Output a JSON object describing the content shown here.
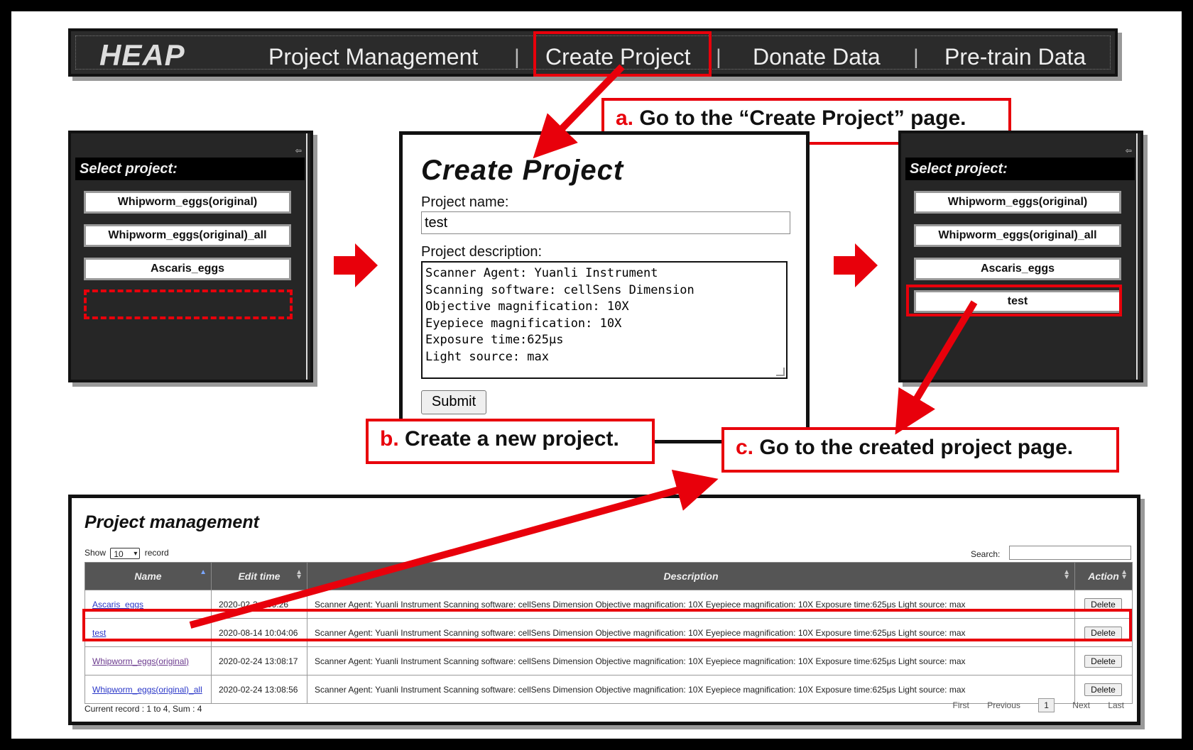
{
  "nav": {
    "logo": "HEAP",
    "items": [
      "Project Management",
      "Create Project",
      "Donate Data",
      "Pre-train Data"
    ],
    "separator": "|"
  },
  "callouts": {
    "a_letter": "a.",
    "a_text": " Go to the “Create Project” page.",
    "b_letter": "b.",
    "b_text": " Create a new project.",
    "c_letter": "c.",
    "c_text": " Go to the created project page."
  },
  "sidebar_before": {
    "header": "Select project:",
    "collapse_icon": "⇦",
    "projects": [
      "Whipworm_eggs(original)",
      "Whipworm_eggs(original)_all",
      "Ascaris_eggs"
    ]
  },
  "sidebar_after": {
    "header": "Select project:",
    "collapse_icon": "⇦",
    "projects": [
      "Whipworm_eggs(original)",
      "Whipworm_eggs(original)_all",
      "Ascaris_eggs",
      "test"
    ]
  },
  "create_form": {
    "title": "Create Project",
    "name_label": "Project name:",
    "name_value": "test",
    "desc_label": "Project description:",
    "desc_value": "Scanner Agent: Yuanli Instrument\nScanning software: cellSens Dimension\nObjective magnification: 10X\nEyepiece magnification: 10X\nExposure time:625μs\nLight source: max",
    "submit_label": "Submit"
  },
  "project_management": {
    "title": "Project management",
    "show_label": "Show",
    "show_value": "10",
    "record_label": "record",
    "search_label": "Search:",
    "columns": [
      "Name",
      "Edit time",
      "Description",
      "Action"
    ],
    "rows": [
      {
        "name": "Ascaris_eggs",
        "time": "2020-02-2... 09:26",
        "desc": "Scanner Agent: Yuanli Instrument Scanning software: cellSens Dimension Objective magnification: 10X Eyepiece magnification: 10X Exposure time:625μs Light source: max",
        "action": "Delete"
      },
      {
        "name": "test",
        "time": "2020-08-14 10:04:06",
        "desc": "Scanner Agent: Yuanli Instrument Scanning software: cellSens Dimension Objective magnification: 10X Eyepiece magnification: 10X Exposure time:625μs Light source: max",
        "action": "Delete"
      },
      {
        "name": "Whipworm_eggs(original)",
        "time": "2020-02-24 13:08:17",
        "desc": "Scanner Agent: Yuanli Instrument Scanning software: cellSens Dimension Objective magnification: 10X Eyepiece magnification: 10X Exposure time:625μs Light source: max",
        "action": "Delete"
      },
      {
        "name": "Whipworm_eggs(original)_all",
        "time": "2020-02-24 13:08:56",
        "desc": "Scanner Agent: Yuanli Instrument Scanning software: cellSens Dimension Objective magnification: 10X Eyepiece magnification: 10X Exposure time:625μs Light source: max",
        "action": "Delete"
      }
    ],
    "footer": "Current record : 1 to 4, Sum : 4",
    "pager": {
      "first": "First",
      "previous": "Previous",
      "current": "1",
      "next": "Next",
      "last": "Last"
    }
  },
  "colors": {
    "accent_red": "#e8000b",
    "nav_bg": "#2b2b2b",
    "header_bg": "#555555"
  }
}
